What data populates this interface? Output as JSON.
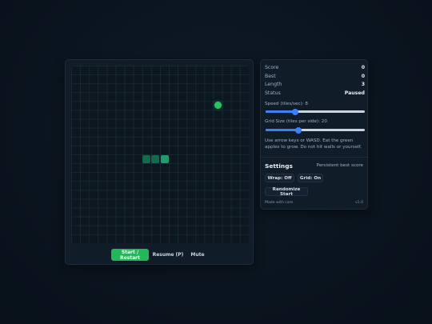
{
  "stats": {
    "score_label": "Score",
    "score": "0",
    "best_label": "Best",
    "best": "0",
    "length_label": "Length",
    "length": "3",
    "status_label": "Status",
    "status": "Paused"
  },
  "speed": {
    "label": "Speed (tiles/sec): 8",
    "value_fraction": 0.3
  },
  "grid_size": {
    "label": "Grid Size (tiles per side): 20",
    "value_fraction": 0.33
  },
  "help_text": "Use arrow keys or WASD. Eat the green apples to grow. Do not hit walls or yourself.",
  "settings": {
    "title": "Settings",
    "note": "Persistent best score",
    "wrap_label": "Wrap: Off",
    "grid_label": "Grid: On",
    "randomize_label": "Randomize Start"
  },
  "footer": {
    "left": "Made with care",
    "right": "v1.0"
  },
  "controls": {
    "start_label": "Start / Restart",
    "resume_label": "Resume (P)",
    "mute_label": "Mute"
  },
  "game": {
    "grid_tiles": 20,
    "snake": [
      [
        8,
        10
      ],
      [
        9,
        10
      ],
      [
        10,
        10
      ]
    ],
    "apple": [
      16,
      4
    ],
    "colors": {
      "snake_head": "#1f9c6a",
      "snake_body": "#166a4c",
      "apple": "#2fc463",
      "accent": "#22b85a",
      "slider": "#3b82f6"
    }
  }
}
